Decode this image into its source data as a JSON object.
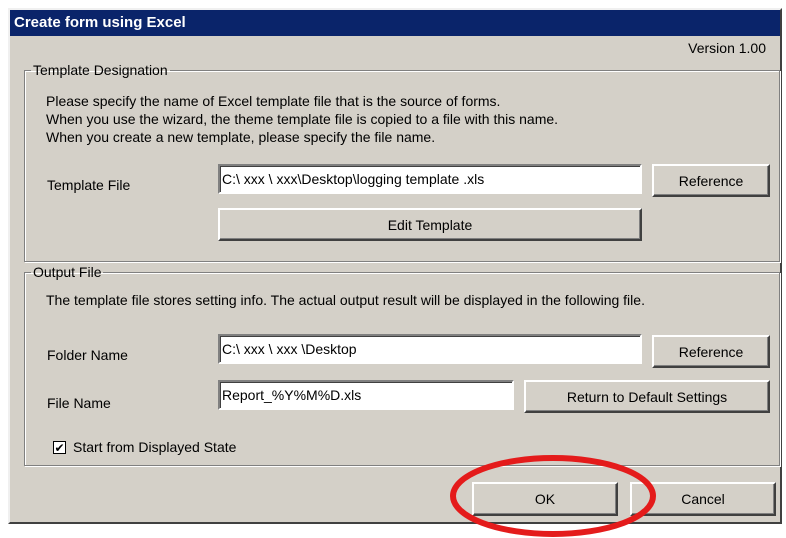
{
  "window": {
    "title": "Create form using Excel",
    "version": "Version 1.00"
  },
  "template_group": {
    "legend": "Template Designation",
    "description": [
      "Please specify the name of Excel template file that is the source of forms.",
      "When you use the wizard, the theme template file is copied to a file with this name.",
      "When you create a new template, please specify the file name."
    ],
    "template_file_label": "Template File",
    "template_file_value": "C:\\ xxx \\ xxx\\Desktop\\logging template .xls",
    "reference_label": "Reference",
    "edit_template_label": "Edit Template"
  },
  "output_group": {
    "legend": "Output File",
    "description": "The template file stores setting info. The actual output result will be displayed in the following file.",
    "folder_name_label": "Folder Name",
    "folder_name_value": "C:\\ xxx \\ xxx \\Desktop",
    "folder_reference_label": "Reference",
    "file_name_label": "File Name",
    "file_name_value": "Report_%Y%M%D.xls",
    "return_default_label": "Return to Default Settings",
    "start_checkbox_label": "Start from Displayed State",
    "start_checkbox_checked": true
  },
  "footer": {
    "ok_label": "OK",
    "cancel_label": "Cancel"
  },
  "colors": {
    "title_bar": "#0a246a",
    "dialog_face": "#d4d0c8",
    "highlight_circle": "#e41b1b"
  }
}
